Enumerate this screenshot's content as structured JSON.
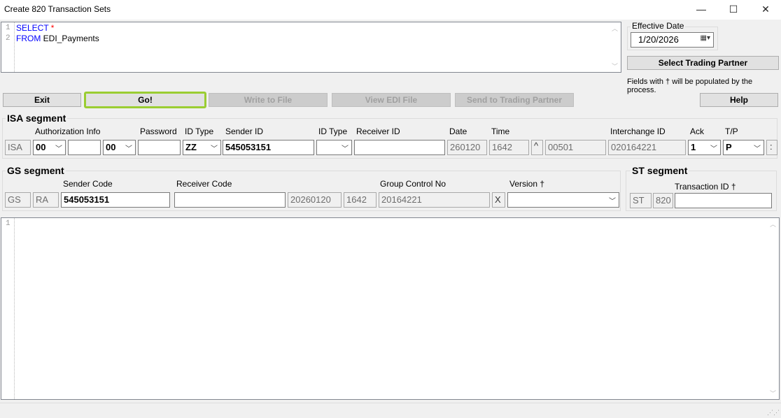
{
  "window": {
    "title": "Create 820 Transaction Sets",
    "minimize": "—",
    "maximize": "☐",
    "close": "✕"
  },
  "sql": {
    "line1_num": "1",
    "line2_num": "2",
    "kw_select": "SELECT",
    "star": " *",
    "kw_from": "FROM",
    "table": " EDI_Payments"
  },
  "effective_date": {
    "label": "Effective Date",
    "value": "1/20/2026"
  },
  "buttons": {
    "select_partner": "Select Trading Partner",
    "exit": "Exit",
    "go": "Go!",
    "write": "Write to File",
    "view": "View EDI File",
    "send": "Send to Trading Partner",
    "help": "Help"
  },
  "hint": "Fields with † will be populated by the process.",
  "isa": {
    "title": "ISA segment",
    "labels": {
      "auth": "Authorization Info",
      "password": "Password",
      "idtype1": "ID Type",
      "sender": "Sender ID",
      "idtype2": "ID Type",
      "receiver": "Receiver ID",
      "date": "Date",
      "time": "Time",
      "interchange": "Interchange ID",
      "ack": "Ack",
      "tp": "T/P"
    },
    "prefix": "ISA",
    "auth_qual": "00",
    "auth_info": "",
    "pw_qual": "00",
    "password": "",
    "id_type1": "ZZ",
    "sender_id": "545053151",
    "id_type2": "",
    "receiver_id": "",
    "date": "260120",
    "time": "1642",
    "repsep": "^",
    "version": "00501",
    "interchange_id": "020164221",
    "ack": "1",
    "tp": "P",
    "compsep": ":"
  },
  "gs": {
    "title": "GS segment",
    "labels": {
      "sender": "Sender Code",
      "receiver": "Receiver Code",
      "gcn": "Group Control No",
      "version": "Version †"
    },
    "prefix": "GS",
    "func": "RA",
    "sender_code": "545053151",
    "receiver_code": "",
    "date": "20260120",
    "time": "1642",
    "group_control": "20164221",
    "agency": "X",
    "version": ""
  },
  "st": {
    "title": "ST segment",
    "labels": {
      "txid": "Transaction ID †"
    },
    "prefix": "ST",
    "code": "820",
    "transaction_id": ""
  },
  "output": {
    "line1_num": "1"
  }
}
